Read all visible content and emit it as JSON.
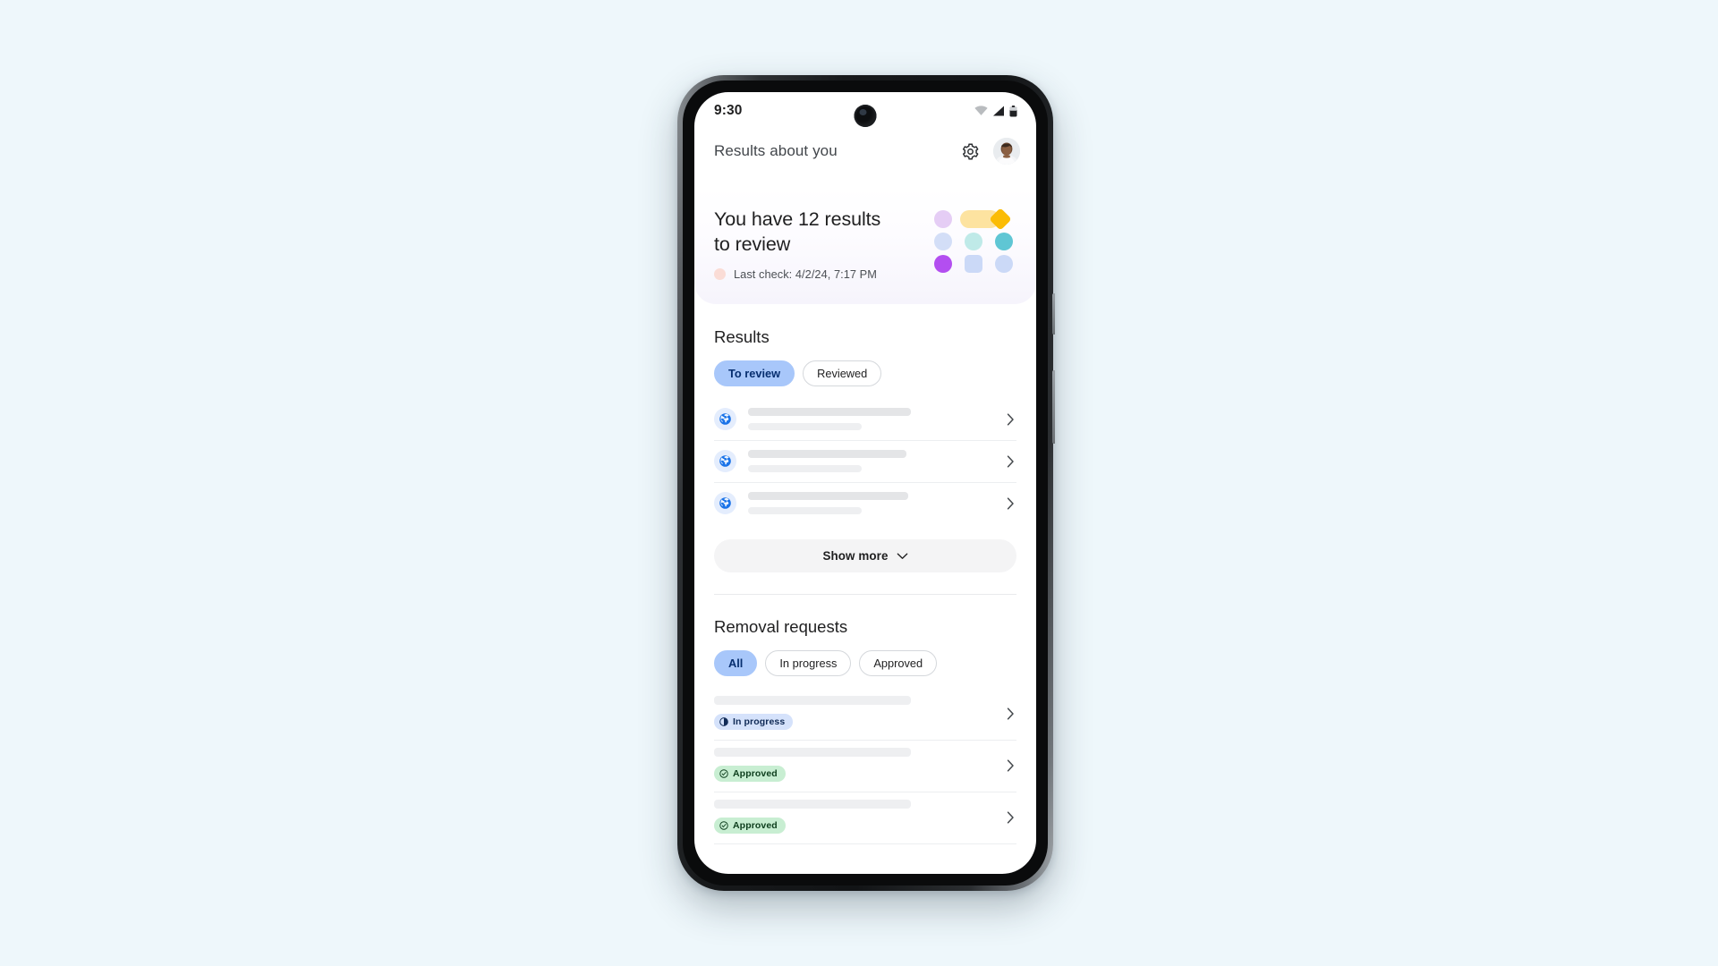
{
  "page": {
    "background_color": "#eef7fb",
    "device": "android-phone-mockup"
  },
  "status_bar": {
    "time": "9:30",
    "icons": [
      {
        "name": "wifi-icon",
        "label": "Wi-Fi"
      },
      {
        "name": "cellular-signal-icon",
        "label": "Mobile signal"
      },
      {
        "name": "battery-icon",
        "label": "Battery"
      }
    ]
  },
  "header": {
    "title": "Results about you",
    "settings_icon": "gear-icon",
    "avatar_icon": "avatar"
  },
  "hero": {
    "headline": "You have 12 results to review",
    "headline_line_1": "You have 12 results",
    "headline_line_2": "to review",
    "results_count": "12",
    "last_check": "Last check: 4/2/24, 7:17 PM",
    "status_dot_color": "#fadcd6",
    "decor": {
      "row1": [
        {
          "shape": "circle",
          "color": "#e5cdf5"
        },
        {
          "shape": "pill-diamond",
          "pill_color": "#fde3a0",
          "diamond_color": "#fbbc06"
        }
      ],
      "row2": [
        {
          "shape": "circle",
          "color": "#d3def7"
        },
        {
          "shape": "circle",
          "color": "#bfeae8"
        },
        {
          "shape": "circle",
          "color": "#5fc6d4"
        }
      ],
      "row3": [
        {
          "shape": "circle",
          "color": "#b34ef0"
        },
        {
          "shape": "square",
          "color": "#cbd9f7"
        },
        {
          "shape": "circle",
          "color": "#cbd9f7"
        }
      ]
    }
  },
  "results_section": {
    "title": "Results",
    "chips": [
      {
        "label": "To review",
        "selected": true
      },
      {
        "label": "Reviewed",
        "selected": false
      }
    ],
    "rows": [
      {
        "icon": "globe-icon",
        "chevron": "chevron-right-icon",
        "placeholder": true,
        "bar_width": "66%"
      },
      {
        "icon": "globe-icon",
        "chevron": "chevron-right-icon",
        "placeholder": true,
        "bar_width": "64%"
      },
      {
        "icon": "globe-icon",
        "chevron": "chevron-right-icon",
        "placeholder": true,
        "bar_width": "65%"
      }
    ],
    "show_more": {
      "label": "Show more",
      "icon": "chevron-down-icon"
    }
  },
  "removal_section": {
    "title": "Removal requests",
    "chips": [
      {
        "label": "All",
        "selected": true
      },
      {
        "label": "In progress",
        "selected": false
      },
      {
        "label": "Approved",
        "selected": false
      }
    ],
    "rows": [
      {
        "status": "In progress",
        "status_kind": "in-progress",
        "status_icon": "half-circle-icon",
        "chevron": "chevron-right-icon"
      },
      {
        "status": "Approved",
        "status_kind": "approved",
        "status_icon": "check-circle-icon",
        "chevron": "chevron-right-icon"
      },
      {
        "status": "Approved",
        "status_kind": "approved",
        "status_icon": "check-circle-icon",
        "chevron": "chevron-right-icon"
      }
    ]
  },
  "colors": {
    "accent_chip": "#a8c7fa",
    "accent_chip_text": "#062e6f",
    "badge_progress_bg": "#d5e2fb",
    "badge_approved_bg": "#c8eed2",
    "page_bg": "#eef7fb"
  }
}
